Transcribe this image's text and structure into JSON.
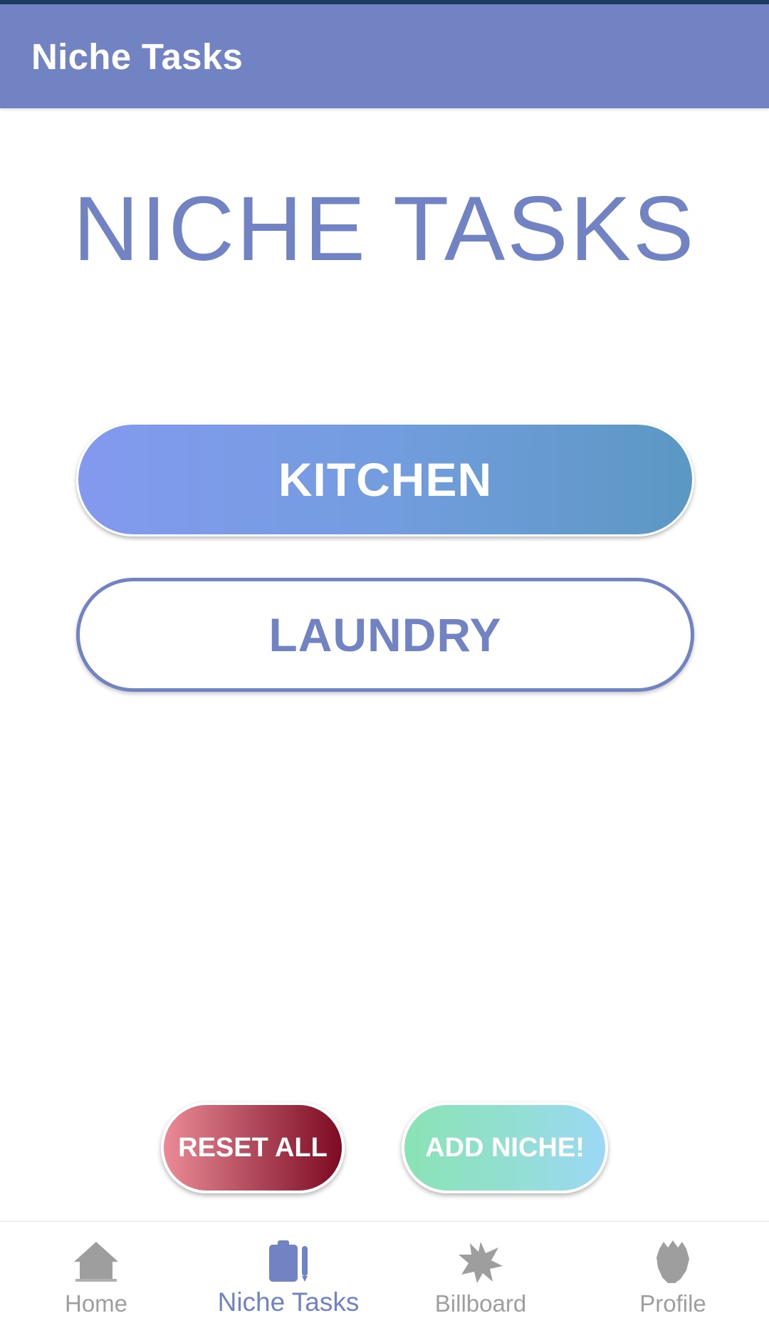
{
  "app_bar": {
    "title": "Niche Tasks"
  },
  "page": {
    "heading": "NICHE TASKS"
  },
  "niches": [
    {
      "label": "KITCHEN",
      "style": "filled"
    },
    {
      "label": "LAUNDRY",
      "style": "outlined"
    }
  ],
  "actions": {
    "reset_label": "RESET ALL",
    "add_label": "ADD NICHE!"
  },
  "bottom_nav": {
    "items": [
      {
        "label": "Home",
        "icon": "house-icon",
        "active": false
      },
      {
        "label": "Niche Tasks",
        "icon": "clipboard-pen-icon",
        "active": true
      },
      {
        "label": "Billboard",
        "icon": "burst-star-icon",
        "active": false
      },
      {
        "label": "Profile",
        "icon": "head-silhouette-icon",
        "active": false
      }
    ]
  },
  "colors": {
    "primary": "#7283c3",
    "status_bar": "#1f3a5f",
    "inactive": "#9e9e9e",
    "reset_gradient": [
      "#ec8b97",
      "#7d0a22"
    ],
    "add_gradient": [
      "#8ae3b5",
      "#9cd8f5"
    ],
    "kitchen_gradient": [
      "#8399ef",
      "#5b98c3"
    ]
  }
}
